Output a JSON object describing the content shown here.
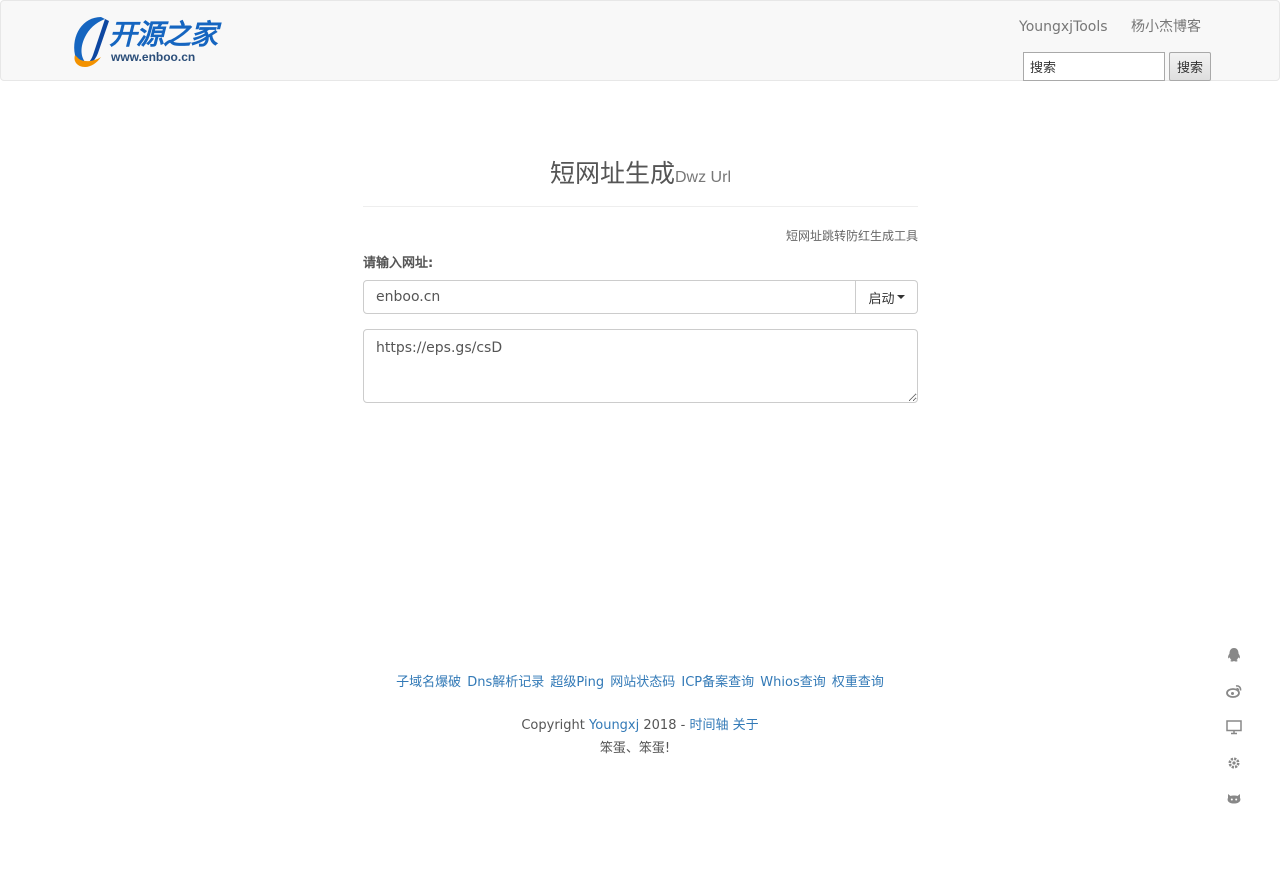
{
  "header": {
    "logo_text_cn": "开源之家",
    "logo_text_en": "www.enboo.cn",
    "nav": [
      {
        "label": "YoungxjTools"
      },
      {
        "label": "杨小杰博客"
      }
    ],
    "search": {
      "value": "搜索",
      "button_label": "搜索"
    }
  },
  "main": {
    "title": "短网址生成",
    "subtitle": "Dwz Url",
    "tool_note": "短网址跳转防红生成工具",
    "field_label": "请输入网址:",
    "url_value": "enboo.cn",
    "start_button": "启动",
    "result_value": "https://eps.gs/csD"
  },
  "footer": {
    "links": [
      {
        "label": "子域名爆破"
      },
      {
        "label": "Dns解析记录"
      },
      {
        "label": "超级Ping"
      },
      {
        "label": "网站状态码"
      },
      {
        "label": "ICP备案查询"
      },
      {
        "label": "Whios查询"
      },
      {
        "label": "权重查询"
      }
    ],
    "copyright_prefix": "Copyright",
    "copyright_author": "Youngxj",
    "copyright_year": "2018 -",
    "timeline": "时间轴",
    "about": "关于",
    "motto": "笨蛋、笨蛋!"
  },
  "side_icons": [
    "qq-icon",
    "weibo-icon",
    "monitor-icon",
    "gear-icon",
    "github-icon"
  ],
  "colors": {
    "link": "#337ab7",
    "navbar_bg": "#f8f8f8",
    "logo_blue": "#1565c0",
    "logo_orange": "#f39200"
  }
}
